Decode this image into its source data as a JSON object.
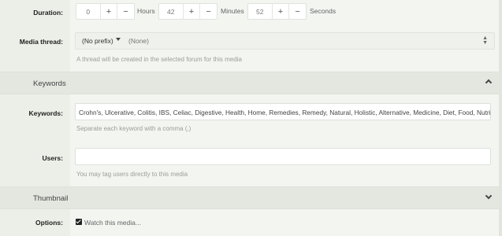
{
  "duration": {
    "label": "Duration:",
    "hours_value": "0",
    "hours_unit": "Hours",
    "minutes_value": "42",
    "minutes_unit": "Minutes",
    "seconds_value": "52",
    "seconds_unit": "Seconds",
    "plus": "+",
    "minus": "−"
  },
  "media_thread": {
    "label": "Media thread:",
    "prefix": "(No prefix)",
    "forum": "(None)",
    "hint": "A thread will be created in the selected forum for this media"
  },
  "keywords_section": {
    "title": "Keywords"
  },
  "keywords": {
    "label": "Keywords:",
    "value": "Crohn's, Ulcerative, Colitis, IBS, Celiac, Digestive, Health, Home, Remedies, Remedy, Natural, Holistic, Alternative, Medicine, Diet, Food, Nutrition",
    "hint": "Separate each keyword with a comma (,)"
  },
  "users": {
    "label": "Users:",
    "value": "",
    "hint": "You may tag users directly to this media"
  },
  "thumbnail_section": {
    "title": "Thumbnail"
  },
  "options": {
    "label": "Options:",
    "watch_label": "Watch this media...",
    "watch_checked": true
  }
}
